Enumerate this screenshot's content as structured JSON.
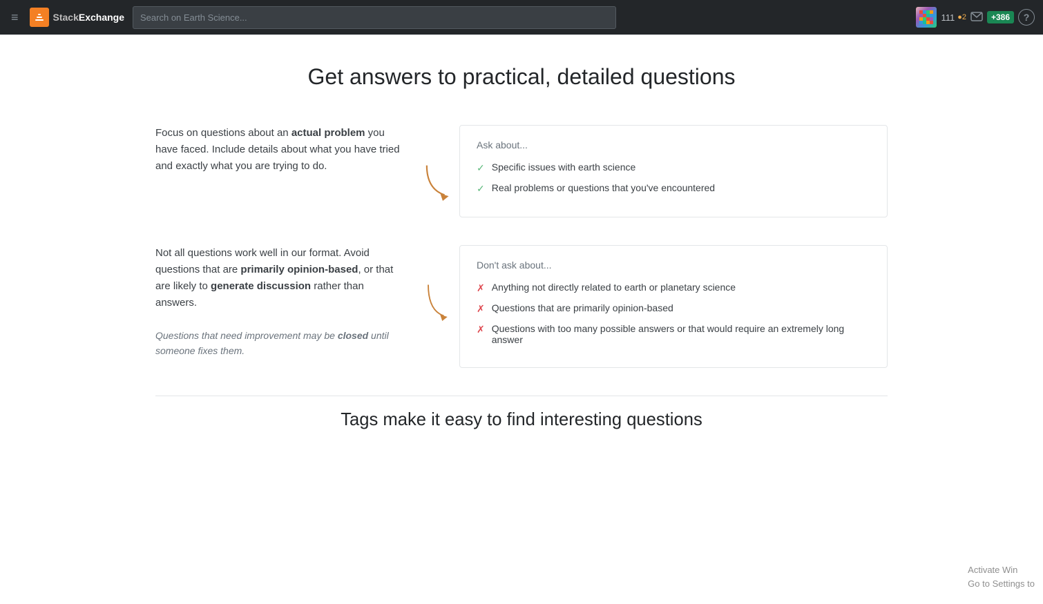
{
  "navbar": {
    "hamburger_label": "≡",
    "logo_stack": "Stack",
    "logo_exchange": "Exchange",
    "search_placeholder": "Search on Earth Science...",
    "rep_score": "111",
    "rep_dots": "●2",
    "rep_badge": "+386",
    "help_label": "?",
    "inbox_label": "✉"
  },
  "page": {
    "title": "Get answers to practical, detailed questions",
    "section1": {
      "text_part1": "Focus on questions about an ",
      "text_bold": "actual problem",
      "text_part2": " you have faced. Include details about what you have tried and exactly what you are trying to do.",
      "box_title": "Ask about...",
      "check_items": [
        "Specific issues with earth science",
        "Real problems or questions that you've encountered"
      ]
    },
    "section2": {
      "text_part1": "Not all questions work well in our format. Avoid questions that are ",
      "text_bold1": "primarily opinion-based",
      "text_mid": ", or that are likely to ",
      "text_bold2": "generate discussion",
      "text_part2": " rather than answers.",
      "italic_note_pre": "Questions that need improvement may be ",
      "italic_note_bold": "closed",
      "italic_note_post": " until someone fixes them.",
      "box_title": "Don't ask about...",
      "cross_items": [
        "Anything not directly related to earth or planetary science",
        "Questions that are primarily opinion-based",
        "Questions with too many possible answers or that would require an extremely long answer"
      ]
    },
    "bottom_title": "Tags make it easy to find interesting questions"
  },
  "watermark": {
    "line1": "Activate Win",
    "line2": "Go to Settings to"
  }
}
